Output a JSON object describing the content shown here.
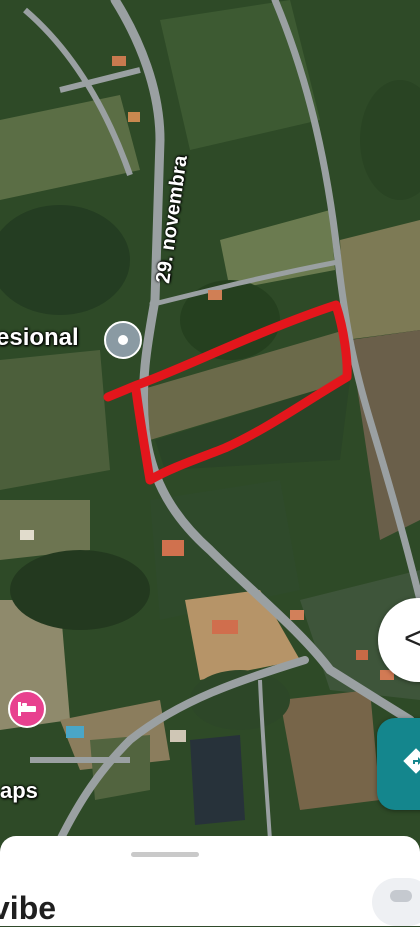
{
  "map": {
    "road_label": "29. novembra",
    "place_label": "esional",
    "hotel_label": "aps"
  },
  "icons": {
    "place_pin": "place-pin-icon",
    "hotel_pin": "hotel-icon",
    "left_fab": "chevron-left-icon",
    "directions_fab": "directions-icon"
  },
  "sheet": {
    "title": "vibe"
  },
  "colors": {
    "highlight_outline": "#e3161c",
    "road": "#9aa0a2",
    "hotel_pin": "#e8418f",
    "directions_button": "#14868d"
  }
}
